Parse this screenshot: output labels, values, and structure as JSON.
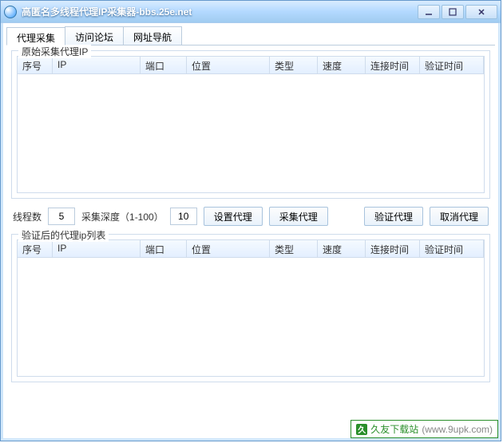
{
  "title": "高匿名多线程代理IP采集器-bbs.25e.net",
  "tabs": {
    "collect": "代理采集",
    "forum": "访问论坛",
    "nav": "网址导航"
  },
  "group1": {
    "legend": "原始采集代理IP"
  },
  "group2": {
    "legend": "验证后的代理ip列表"
  },
  "columns": {
    "seq": "序号",
    "ip": "IP",
    "port": "端口",
    "loc": "位置",
    "type": "类型",
    "speed": "速度",
    "conn": "连接时间",
    "verify": "验证时间"
  },
  "controls": {
    "threads_label": "线程数",
    "threads_value": "5",
    "depth_label": "采集深度（1-100）",
    "depth_value": "10",
    "btn_set": "设置代理",
    "btn_collect": "采集代理",
    "btn_verify": "验证代理",
    "btn_cancel": "取消代理"
  },
  "watermark": {
    "name": "久友下载站",
    "url": "(www.9upk.com)"
  }
}
